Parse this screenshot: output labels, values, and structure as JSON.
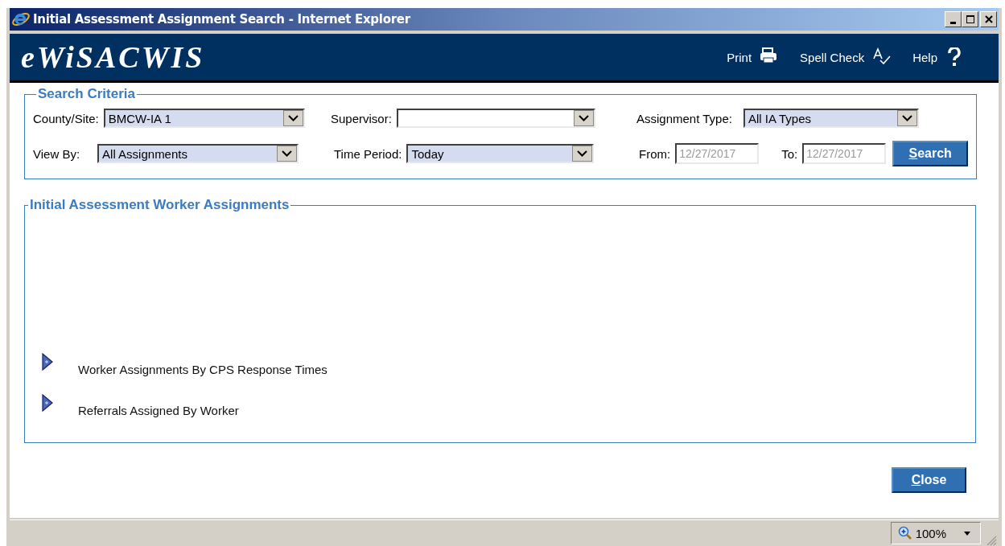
{
  "window": {
    "title": "Initial Assessment Assignment Search - Internet Explorer"
  },
  "header": {
    "logo": "eWiSACWIS",
    "actions": [
      {
        "label": "Print",
        "kind": "print"
      },
      {
        "label": "Spell Check",
        "kind": "spell"
      },
      {
        "label": "Help",
        "kind": "help"
      }
    ]
  },
  "search_criteria": {
    "title": "Search Criteria",
    "rows": [
      [
        {
          "kind": "select",
          "label": "County/Site:",
          "value": "BMCW-IA 1"
        },
        {
          "kind": "select",
          "label": "Supervisor:"
        },
        {
          "kind": "select",
          "label": "Assignment Type:",
          "value": "All IA Types"
        }
      ],
      [
        {
          "kind": "select",
          "label": "View By:",
          "value": "All Assignments"
        },
        {
          "kind": "select",
          "label": "Time Period:",
          "value": "Today"
        },
        {
          "kind": "date",
          "label": "From:",
          "value": "12/27/2017",
          "disabled": true
        },
        {
          "kind": "date",
          "label": "To:",
          "value": "12/27/2017",
          "disabled": true
        },
        {
          "kind": "button",
          "label": "Search",
          "access_key_underlined": true
        }
      ]
    ]
  },
  "assignments": {
    "title": "Initial Assessment Worker Assignments",
    "sections": [
      {
        "label": "Worker Assignments By CPS Response Times",
        "expanded": false
      },
      {
        "label": "Referrals Assigned By Worker",
        "expanded": false
      }
    ]
  },
  "close_button": {
    "label": "Close",
    "access_key_underlined": true
  },
  "status_bar": {
    "zoom": "100%"
  }
}
